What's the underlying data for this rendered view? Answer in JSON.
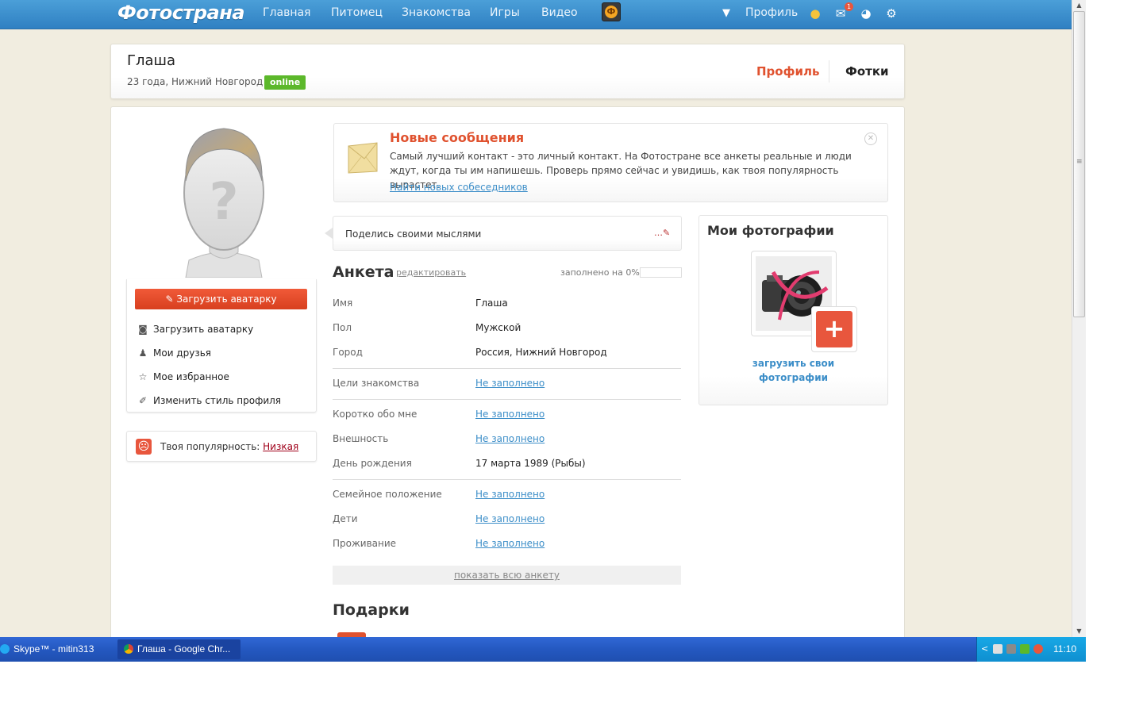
{
  "nav": {
    "logo": "Фотострана",
    "links": [
      "Главная",
      "Питомец",
      "Знакомства",
      "Игры",
      "Видео"
    ],
    "game_icon_letter": "Ф",
    "profile_label": "Профиль",
    "messages_badge": "1"
  },
  "header": {
    "name": "Глаша",
    "meta": "23 года, Нижний Новгород",
    "status": "online",
    "tabs": {
      "profile": "Профиль",
      "photos": "Фотки"
    }
  },
  "sidebar": {
    "upload_button": "Загрузить аватарку",
    "menu": [
      {
        "label": "Загрузить аватарку",
        "icon": "camera-icon"
      },
      {
        "label": "Мои друзья",
        "icon": "friends-icon"
      },
      {
        "label": "Мое избранное",
        "icon": "star-icon"
      },
      {
        "label": "Изменить стиль профиля",
        "icon": "brush-icon"
      }
    ],
    "popularity": {
      "label": "Твоя популярность:",
      "value": "Низкая"
    }
  },
  "banner": {
    "title": "Новые сообщения",
    "text": "Самый лучший контакт - это личный контакт. На Фотостране все анкеты реальные и люди ждут, когда ты им напишешь. Проверь прямо сейчас и увидишь, как твоя популярность вырастет.",
    "link": "Найти новых собеседников"
  },
  "thoughts": {
    "placeholder": "Поделись своими мыслями"
  },
  "anketa": {
    "title": "Анкета",
    "edit": "редактировать",
    "filled_label": "заполнено на 0%",
    "filled_fraction": 0,
    "rows": [
      {
        "label": "Имя",
        "value": "Глаша"
      },
      {
        "label": "Пол",
        "value": "Мужской"
      },
      {
        "label": "Город",
        "value": "Россия, Нижний Новгород"
      },
      {
        "label": "Цели знакомства",
        "value": "Не заполнено"
      },
      {
        "label": "Коротко обо мне",
        "value": "Не заполнено"
      },
      {
        "label": "Внешность",
        "value": "Не заполнено"
      },
      {
        "label": "День рождения",
        "value": "17 марта 1989 (Рыбы)"
      },
      {
        "label": "Семейное положение",
        "value": "Не заполнено"
      },
      {
        "label": "Дети",
        "value": "Не заполнено"
      },
      {
        "label": "Проживание",
        "value": "Не заполнено"
      }
    ],
    "show_all": "показать всю анкету"
  },
  "gifts": {
    "title": "Подарки"
  },
  "photos": {
    "title": "Мои фотографии",
    "upload_line1": "загрузить свои",
    "upload_line2": "фотографии"
  },
  "taskbar": {
    "skype": "Skype™ - mitin313",
    "chrome": "Глаша - Google Chr...",
    "clock": "11:10"
  },
  "colors": {
    "accent": "#e0522f",
    "nav_blue": "#2f80c2",
    "link_blue": "#3c8ec8",
    "online_green": "#5cb82b",
    "page_bg": "#f1ede0"
  }
}
